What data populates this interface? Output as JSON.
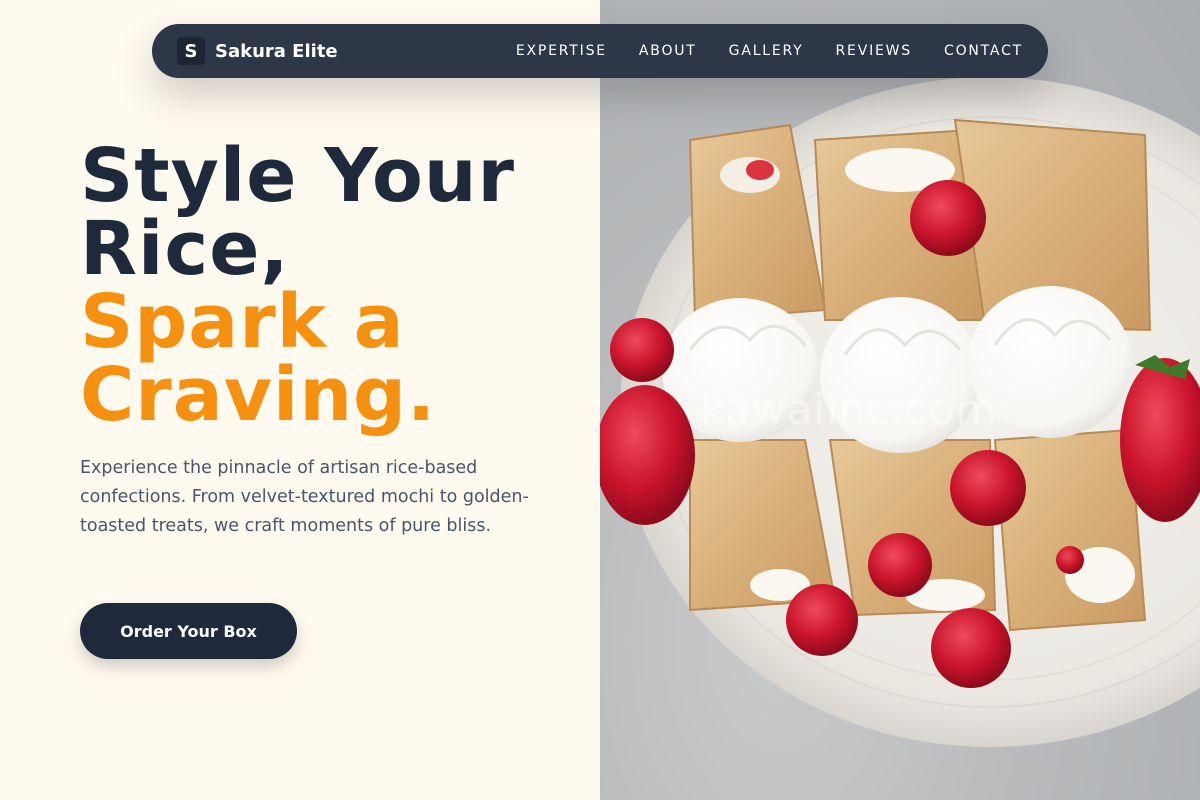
{
  "brand": {
    "logo_letter": "S",
    "name": "Sakura Elite"
  },
  "nav": {
    "links": [
      {
        "label": "EXPERTISE"
      },
      {
        "label": "ABOUT"
      },
      {
        "label": "GALLERY"
      },
      {
        "label": "REVIEWS"
      },
      {
        "label": "CONTACT"
      }
    ]
  },
  "hero": {
    "headline_line1": "Style Your",
    "headline_line2": "Rice,",
    "headline_accent_line1": "Spark a",
    "headline_accent_line2": "Craving.",
    "description": "Experience the pinnacle of artisan rice-based confections. From velvet-textured mochi to golden-toasted treats, we craft moments of pure bliss.",
    "cta_label": "Order Your Box",
    "image_watermark": "kawaiinc.com"
  },
  "colors": {
    "background": "#fffaef",
    "navbar": "#2d3748",
    "headline": "#1e293b",
    "accent": "#f59010",
    "body_text": "#4a5568"
  }
}
